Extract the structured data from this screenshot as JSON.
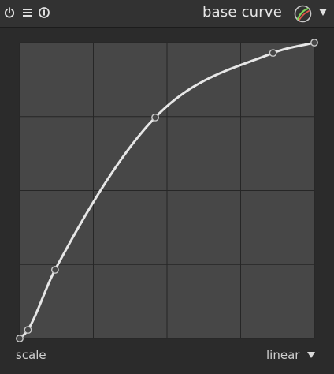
{
  "header": {
    "title": "base curve"
  },
  "icons": {
    "power": "power-icon",
    "presets": "presets-icon",
    "reset": "reset-icon",
    "blend": "blend-icon",
    "expand": "triangle-down-icon",
    "mode_dropdown": "triangle-down-icon"
  },
  "chart_data": {
    "type": "line",
    "grid": true,
    "grid_divisions": 4,
    "xlim": [
      0,
      1
    ],
    "ylim": [
      0,
      1
    ],
    "control_points": [
      {
        "x": 0.0,
        "y": 0.0
      },
      {
        "x": 0.028,
        "y": 0.029
      },
      {
        "x": 0.12,
        "y": 0.232
      },
      {
        "x": 0.46,
        "y": 0.747
      },
      {
        "x": 0.86,
        "y": 0.965
      },
      {
        "x": 1.0,
        "y": 1.0
      }
    ]
  },
  "footer": {
    "scale_label": "scale",
    "mode_label": "linear"
  },
  "colors": {
    "background": "#2b2b2b",
    "graph_bg": "#474747",
    "grid": "#262626",
    "curve": "#e6e6e6"
  }
}
